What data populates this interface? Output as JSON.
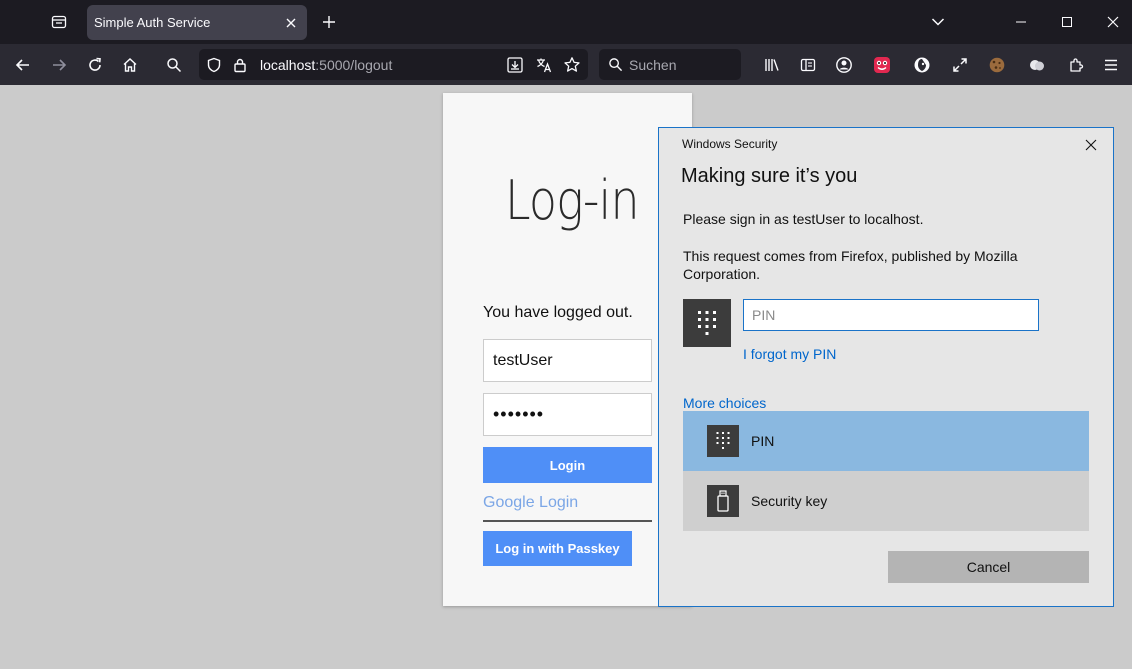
{
  "browser": {
    "tab_title": "Simple Auth Service",
    "url_host": "localhost",
    "url_path": ":5000/logout",
    "search_placeholder": "Suchen"
  },
  "login": {
    "heading": "Log-in",
    "message": "You have logged out.",
    "username_value": "testUser",
    "password_value": "•••••••",
    "login_button": "Login",
    "google_login": "Google Login",
    "passkey_button": "Log in with Passkey"
  },
  "dialog": {
    "caption": "Windows Security",
    "title": "Making sure it’s you",
    "sign_in_text": "Please sign in as testUser to localhost.",
    "request_text": "This request comes from Firefox, published by Mozilla Corporation.",
    "pin_placeholder": "PIN",
    "forgot_pin": "I forgot my PIN",
    "more_choices": "More choices",
    "choices": [
      {
        "label": "PIN",
        "icon": "keypad-icon"
      },
      {
        "label": "Security key",
        "icon": "usb-key-icon"
      }
    ],
    "cancel": "Cancel"
  },
  "colors": {
    "accent": "#4f8ff7",
    "link": "#0066cc",
    "selected_choice": "#8ab8e0",
    "dialog_border": "#1a73c8"
  }
}
